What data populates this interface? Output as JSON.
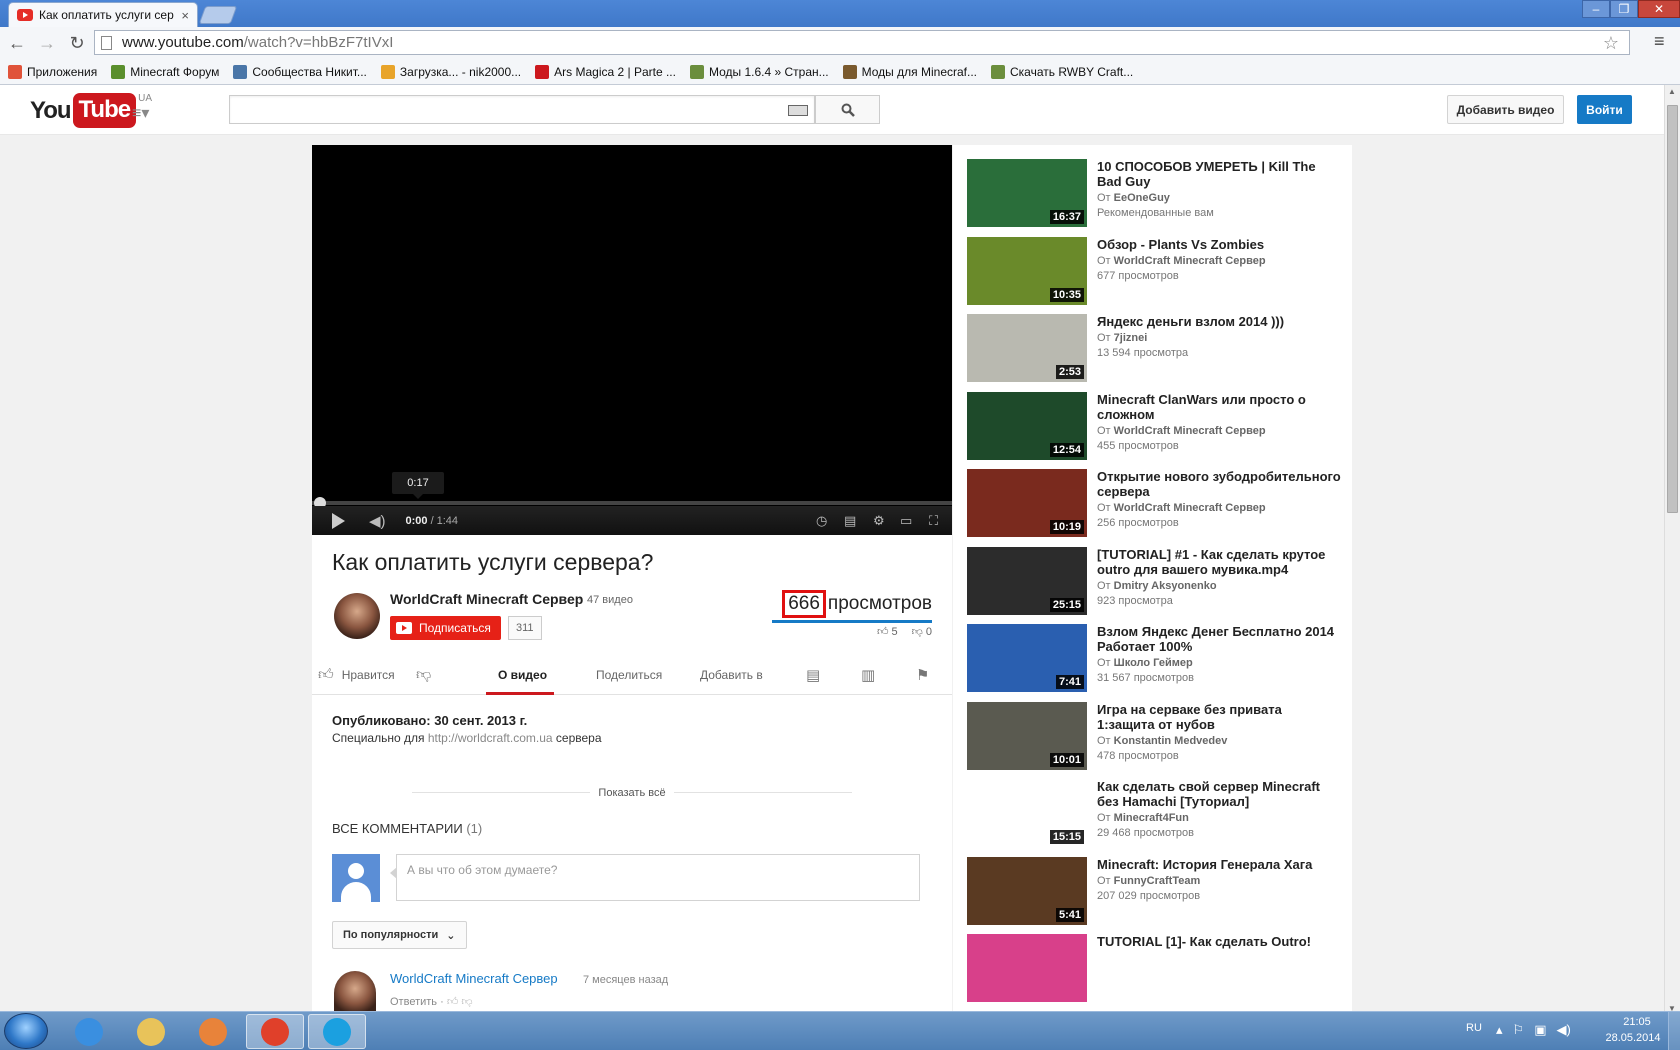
{
  "browser": {
    "tab_title": "Как оплатить услуги сер",
    "tab_close": "×",
    "url_host": "www.youtube.com",
    "url_path": "/watch?v=hbBzF7tIVxI",
    "bookmarks": [
      {
        "label": "Приложения",
        "color": "#e0533a"
      },
      {
        "label": "Minecraft Форум",
        "color": "#5a8f2d"
      },
      {
        "label": "Сообщества Никит...",
        "color": "#4a76a8"
      },
      {
        "label": "Загрузка... - nik2000...",
        "color": "#e8a42a"
      },
      {
        "label": "Ars Magica 2 | Parte ...",
        "color": "#cc181e"
      },
      {
        "label": "Моды 1.6.4 » Стран...",
        "color": "#6b8e3d"
      },
      {
        "label": "Моды для Minecraf...",
        "color": "#7a5a2e"
      },
      {
        "label": "Скачать RWBY Craft...",
        "color": "#6b8e3d"
      }
    ]
  },
  "masthead": {
    "logo_you": "You",
    "logo_tube": "Tube",
    "logo_region": "UA",
    "upload_label": "Добавить видео",
    "signin_label": "Войти"
  },
  "player": {
    "tooltip_time": "0:17",
    "time_current": "0:00",
    "time_separator": "/",
    "time_duration": "1:44",
    "progress_fraction": 0
  },
  "video": {
    "title": "Как оплатить услуги сервера?",
    "owner": "WorldCraft Minecraft Сервер",
    "owner_dot": "·",
    "owner_videos": "47 видео",
    "subscribe_label": "Подписаться",
    "subscriber_count": "311",
    "views_number": "666",
    "views_label": "просмотров",
    "likes": "5",
    "dislikes": "0"
  },
  "actions": {
    "like_label": "Нравится",
    "tab_about": "О видео",
    "tab_share": "Поделиться",
    "tab_add": "Добавить в"
  },
  "description": {
    "published": "Опубликовано: 30 сент. 2013 г.",
    "prefix": "Специально для",
    "link": "http://worldcraft.com.ua",
    "suffix": "сервера",
    "show_more": "Показать всё"
  },
  "comments": {
    "heading": "ВСЕ КОММЕНТАРИИ",
    "count": "(1)",
    "placeholder": "А вы что об этом думаете?",
    "sort_label": "По популярности",
    "first": {
      "author": "WorldCraft Minecraft Сервер",
      "time": "7 месяцев назад",
      "reply": "Ответить",
      "reply_dot": "·"
    }
  },
  "related": [
    {
      "title": "10 СПОСОБОВ УМЕРЕТЬ | Kill The Bad Guy",
      "byline": "От",
      "channel": "EeOneGuy",
      "meta": "Рекомендованные вам",
      "duration": "16:37",
      "thumb_color": "#2a6e3a"
    },
    {
      "title": "Обзор - Plants Vs Zombies",
      "byline": "От",
      "channel": "WorldCraft Minecraft Сервер",
      "meta": "677 просмотров",
      "duration": "10:35",
      "thumb_color": "#6a8a2a"
    },
    {
      "title": "Яндекс деньги взлом 2014 )))",
      "byline": "От",
      "channel": "7jiznei",
      "meta": "13 594 просмотра",
      "duration": "2:53",
      "thumb_color": "#b9b9b0"
    },
    {
      "title": "Minecraft ClanWars или просто о сложном",
      "byline": "От",
      "channel": "WorldCraft Minecraft Сервер",
      "meta": "455 просмотров",
      "duration": "12:54",
      "thumb_color": "#1e4a2a"
    },
    {
      "title": "Открытие нового зубодробительного сервера",
      "byline": "От",
      "channel": "WorldCraft Minecraft Сервер",
      "meta": "256 просмотров",
      "duration": "10:19",
      "thumb_color": "#7a2a1e"
    },
    {
      "title": "[TUTORIAL] #1 - Как сделать крутое outro для вашего мувика.mp4",
      "byline": "От",
      "channel": "Dmitry Aksyonenko",
      "meta": "923 просмотра",
      "duration": "25:15",
      "thumb_color": "#2c2c2c"
    },
    {
      "title": "Взлом Яндекс Денег Бесплатно 2014 Работает 100%",
      "byline": "От",
      "channel": "Школо Геймер",
      "meta": "31 567 просмотров",
      "duration": "7:41",
      "thumb_color": "#2a5fb0"
    },
    {
      "title": "Игра на серваке без привата 1:защита от нубов",
      "byline": "От",
      "channel": "Konstantin Medvedev",
      "meta": "478 просмотров",
      "duration": "10:01",
      "thumb_color": "#5a5a50"
    },
    {
      "title": "Как сделать свой сервер Minecraft без Hamachi [Туториал]",
      "byline": "От",
      "channel": "Minecraft4Fun",
      "meta": "29 468 просмотров",
      "duration": "15:15",
      "thumb_color": "#ffffff"
    },
    {
      "title": "Minecraft: История Генерала Хага",
      "byline": "От",
      "channel": "FunnyCraftTeam",
      "meta": "207 029 просмотров",
      "duration": "5:41",
      "thumb_color": "#5a3a22"
    },
    {
      "title": "TUTORIAL [1]- Как сделать Outro!",
      "byline": "",
      "channel": "",
      "meta": "",
      "duration": "",
      "thumb_color": "#d8408a"
    }
  ],
  "taskbar": {
    "apps": [
      {
        "name": "ie",
        "color": "#3a8fe0"
      },
      {
        "name": "explorer",
        "color": "#e8c35a"
      },
      {
        "name": "media-player",
        "color": "#e8833a"
      },
      {
        "name": "chrome",
        "color": "#e0402a"
      },
      {
        "name": "skype",
        "color": "#1ba0e0"
      }
    ],
    "lang": "RU",
    "time": "21:05",
    "date": "28.05.2014"
  }
}
